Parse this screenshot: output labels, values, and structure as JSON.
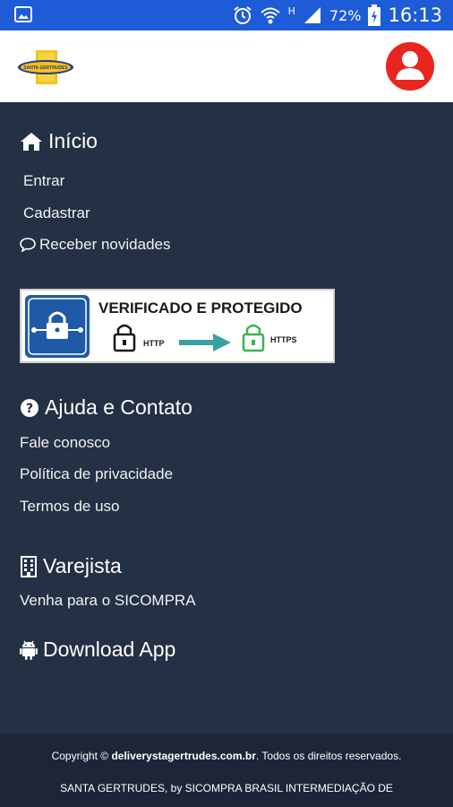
{
  "status_bar": {
    "battery_percent": "72%",
    "time": "16:13",
    "icons": [
      "image-icon",
      "alarm-icon",
      "wifi-icon",
      "network-h-icon",
      "signal-icon",
      "battery-icon"
    ]
  },
  "header": {
    "logo_text": "SANTA GERTRUDES",
    "profile_icon": "user-icon",
    "accent_color": "#e8251f"
  },
  "menu": {
    "inicio": {
      "title": "Início",
      "icon": "home-icon",
      "items": [
        "Entrar",
        "Cadastrar",
        "Receber novidades"
      ]
    },
    "badge": {
      "title": "VERIFICADO E PROTEGIDO",
      "from_label": "HTTP",
      "to_label": "HTTPS"
    },
    "ajuda": {
      "title": "Ajuda e Contato",
      "icon": "question-circle-icon",
      "items": [
        "Fale conosco",
        "Política de privacidade",
        "Termos de uso"
      ]
    },
    "varejista": {
      "title": "Varejista",
      "icon": "building-icon",
      "items": [
        "Venha para o SICOMPRA"
      ]
    },
    "download": {
      "title": "Download App",
      "icon": "android-icon"
    }
  },
  "footer": {
    "copyright_prefix": "Copyright ©",
    "site": "deliverystagertrudes.com.br",
    "copyright_suffix": ". Todos os direitos reservados.",
    "company": "SANTA GERTRUDES, by SICOMPRA BRASIL INTERMEDIAÇÃO DE"
  },
  "colors": {
    "status_bar": "#1e5bd6",
    "menu_bg": "#243044",
    "footer_bg": "#1c2638",
    "badge_blue": "#1f5aa6",
    "badge_green": "#3fb34f",
    "arrow_teal": "#3aa0a0"
  }
}
